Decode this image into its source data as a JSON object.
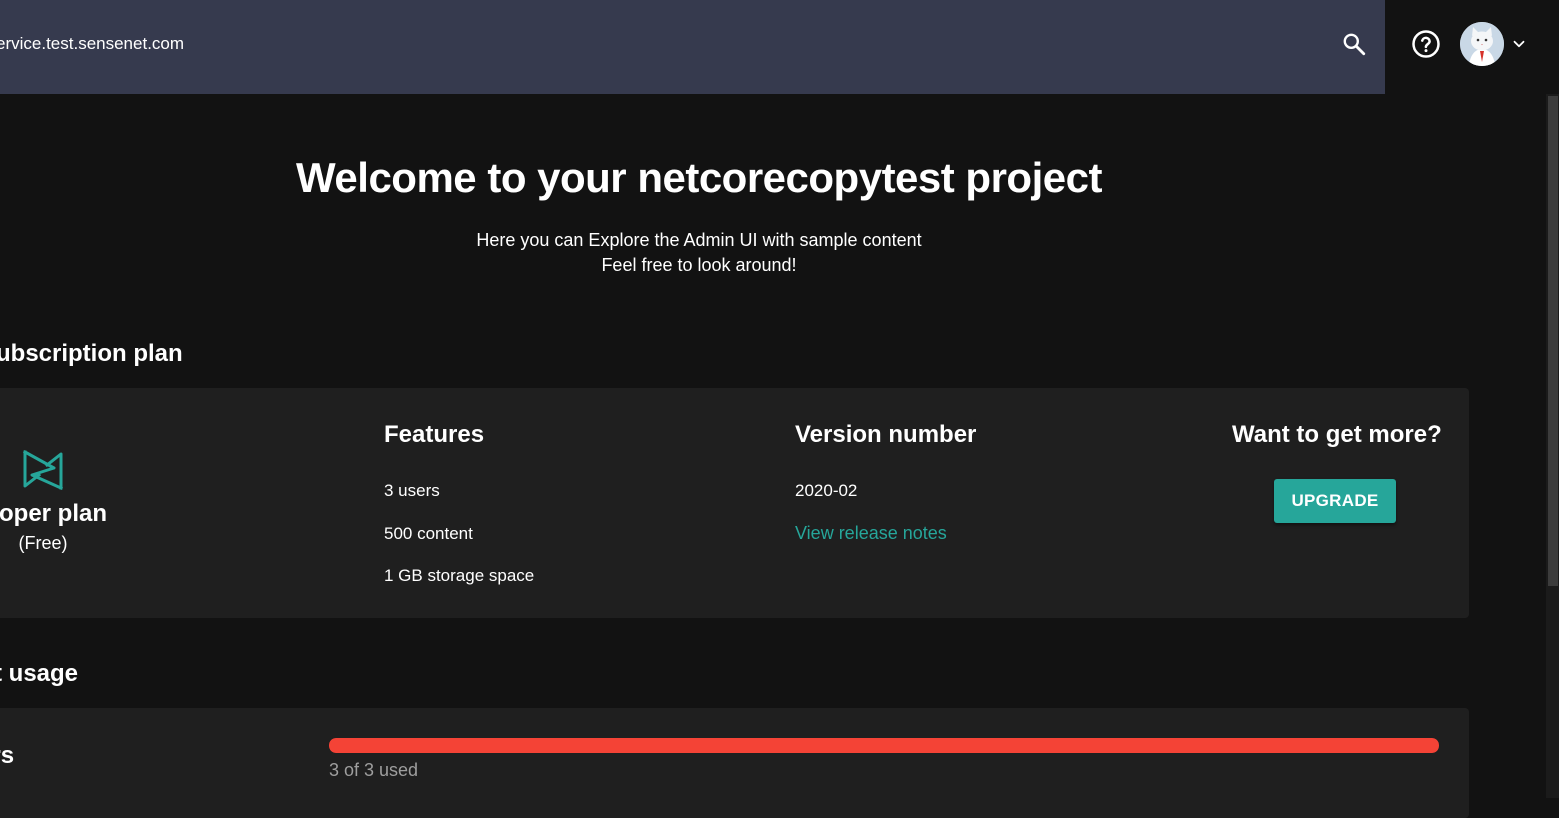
{
  "header": {
    "url_text": "ervice.test.sensenet.com",
    "icons": {
      "search": "search-icon",
      "help": "help-circle-icon",
      "avatar": "user-avatar",
      "menu": "chevron-down-icon"
    }
  },
  "welcome": {
    "title": "Welcome to your netcorecopytest project",
    "line1": "Here you can Explore the Admin UI with sample content",
    "line2": "Feel free to look around!"
  },
  "subscription": {
    "heading": "ubscription plan",
    "plan_name": "eloper plan",
    "plan_price": "(Free)",
    "features_heading": "Features",
    "features": [
      "3 users",
      "500 content",
      "1 GB storage space"
    ],
    "version_heading": "Version number",
    "version": "2020-02",
    "release_notes_link": "View release notes",
    "more_heading": "Want to get more?",
    "upgrade_label": "UPGRADE"
  },
  "usage": {
    "heading": "t usage",
    "users_label": "ers",
    "users_used": 3,
    "users_total": 3,
    "users_fraction": 1.0,
    "users_text": "3 of 3 used"
  },
  "colors": {
    "topbar": "#363a4e",
    "background": "#121212",
    "card": "#1f1f1f",
    "accent": "#26a69a",
    "progress": "#f44336"
  }
}
